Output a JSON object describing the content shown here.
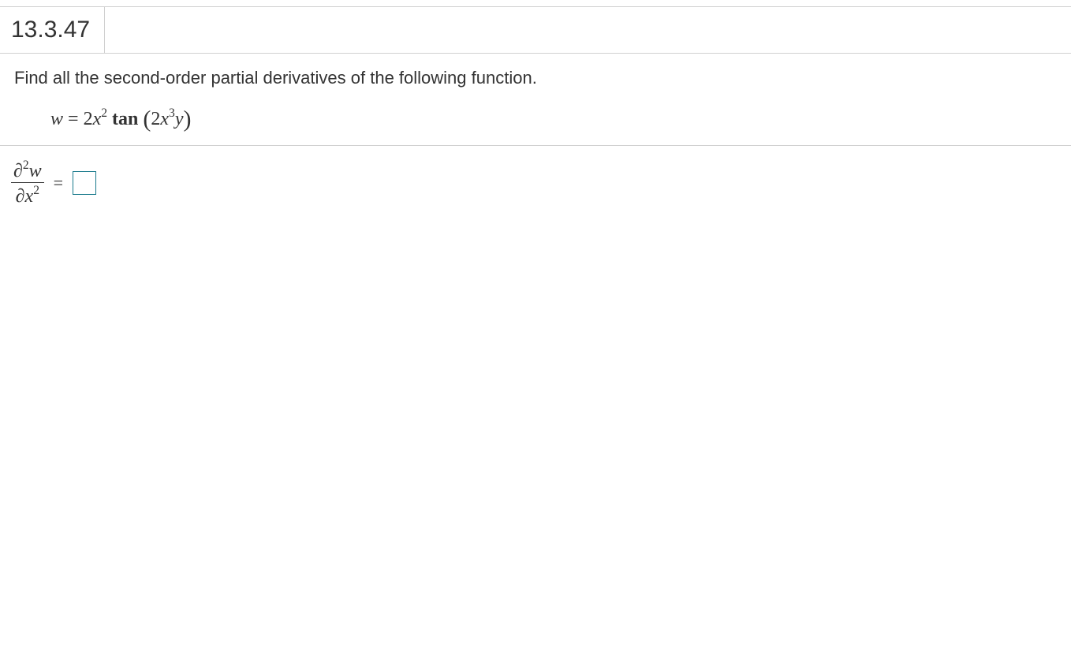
{
  "problem_number": "13.3.47",
  "prompt": "Find all the second-order partial derivatives of the following function.",
  "equation": {
    "lhs": "w",
    "equals": "=",
    "coef": "2",
    "var1": "x",
    "exp1": "2",
    "fn": "tan",
    "inner_coef": "2",
    "inner_var1": "x",
    "inner_exp1": "3",
    "inner_var2": "y"
  },
  "answer": {
    "partial": "∂",
    "exp_top": "2",
    "var_w": "w",
    "var_x": "x",
    "exp_bot": "2",
    "equals": "="
  }
}
